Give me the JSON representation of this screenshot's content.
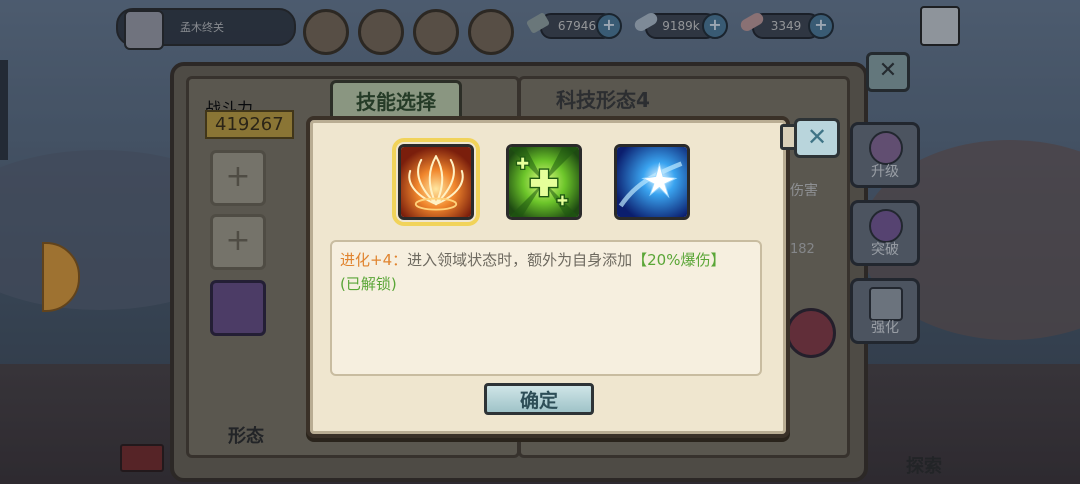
{
  "colors": {
    "accent_gold": "#f1d35a",
    "evolve_orange": "#e0842f",
    "bonus_green": "#5aa637",
    "modal_bg": "#efe6cf",
    "confirm_bg": "#9fc3c8"
  },
  "header": {
    "player_name": "孟木终关",
    "resources": [
      {
        "icon": "wrench-icon",
        "value": "67946"
      },
      {
        "icon": "capsule-icon",
        "value": "9189k"
      },
      {
        "icon": "pill-icon",
        "value": "3349"
      }
    ]
  },
  "background": {
    "combat_power_label": "战斗力",
    "combat_power_value": "419267",
    "tab_label": "技能选择",
    "page_title": "科技形态4",
    "damage_label": "伤害",
    "partial_value": "182",
    "side_buttons": [
      "升级",
      "突破",
      "强化"
    ],
    "bottom_tabs": [
      "形态",
      "探索"
    ]
  },
  "modal": {
    "skills": [
      {
        "name": "flame-burst-skill-icon",
        "selected": true
      },
      {
        "name": "green-heal-skill-icon",
        "selected": false
      },
      {
        "name": "blue-star-skill-icon",
        "selected": false
      }
    ],
    "desc_evolve": "进化+4：",
    "desc_body": "进入领域状态时，额外为自身添加",
    "desc_bonus": "【20%爆伤】",
    "desc_status": "(已解锁)",
    "confirm_label": "确定"
  }
}
